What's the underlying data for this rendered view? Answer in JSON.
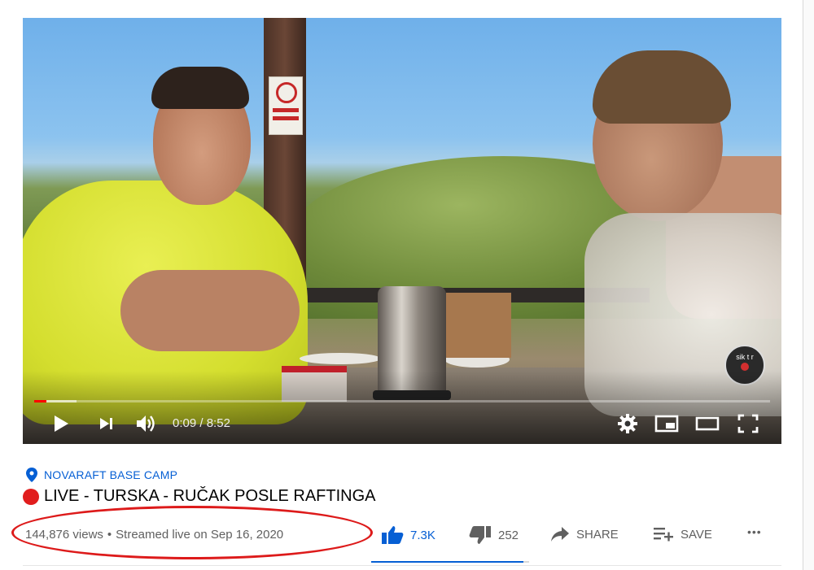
{
  "player": {
    "current_time": "0:09",
    "separator": " / ",
    "duration": "8:52",
    "progress_fraction": 0.017,
    "buffered_fraction": 0.057,
    "channel_logo_text": "sik t r"
  },
  "video": {
    "location": "NOVARAFT BASE CAMP",
    "title": "LIVE - TURSKA - RUČAK POSLE RAFTINGA",
    "views": "144,876 views",
    "dot": "•",
    "date": "Streamed live on Sep 16, 2020"
  },
  "actions": {
    "likes": "7.3K",
    "dislikes": "252",
    "share": "SHARE",
    "save": "SAVE",
    "more": "•••",
    "like_ratio": 0.966
  },
  "colors": {
    "accent_blue": "#065fd4",
    "live_red": "#e11d1d",
    "progress_red": "#ff0000",
    "annotation_red": "#dd1a1a"
  },
  "icons": [
    "play-icon",
    "next-icon",
    "volume-icon",
    "settings-icon",
    "miniplayer-icon",
    "theater-icon",
    "fullscreen-icon",
    "location-pin-icon",
    "thumbs-up-icon",
    "thumbs-down-icon",
    "share-icon",
    "save-playlist-icon",
    "more-icon"
  ]
}
